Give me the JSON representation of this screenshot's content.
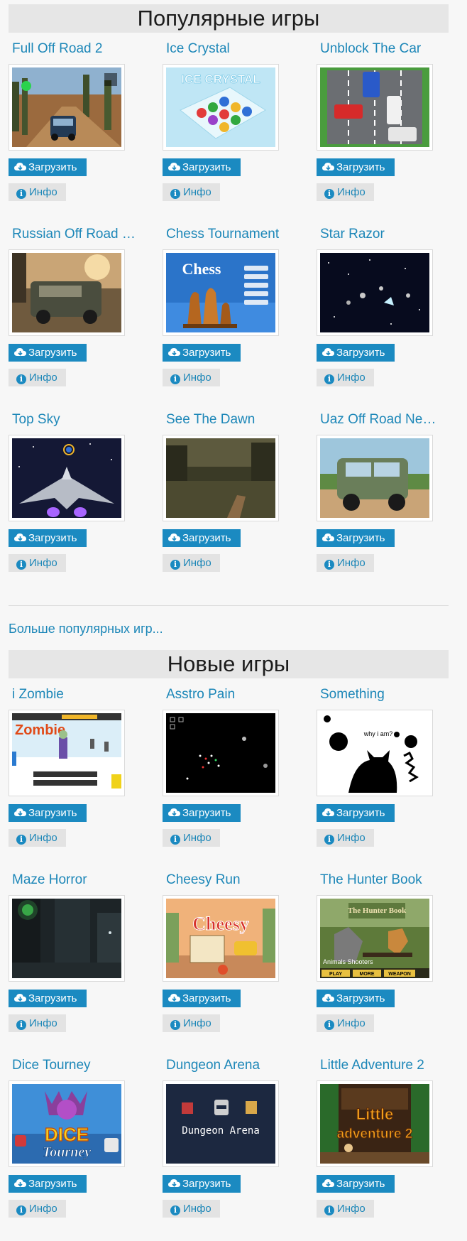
{
  "popular": {
    "title": "Популярные игры",
    "more": "Больше популярных игр...",
    "games": [
      {
        "title": "Full Off Road 2"
      },
      {
        "title": "Ice Crystal"
      },
      {
        "title": "Unblock The Car"
      },
      {
        "title": "Russian Off Road …"
      },
      {
        "title": "Chess Tournament"
      },
      {
        "title": "Star Razor"
      },
      {
        "title": "Top Sky"
      },
      {
        "title": "See The Dawn"
      },
      {
        "title": "Uaz Off Road Ne…"
      }
    ]
  },
  "newgames": {
    "title": "Новые игры",
    "games": [
      {
        "title": "i Zombie"
      },
      {
        "title": "Asstro Pain"
      },
      {
        "title": "Something"
      },
      {
        "title": "Maze Horror"
      },
      {
        "title": "Cheesy Run"
      },
      {
        "title": "The Hunter Book"
      },
      {
        "title": "Dice Tourney"
      },
      {
        "title": "Dungeon Arena"
      },
      {
        "title": "Little Adventure 2"
      }
    ]
  },
  "buttons": {
    "download": "Загрузить",
    "info": "Инфо"
  },
  "thumb_text": {
    "ice_crystal": "ICE CRYSTAL",
    "chess": "Chess",
    "izombie": "Zombie",
    "something": "why i am?",
    "cheesy": "Cheesy",
    "hunter": "The Hunter Book",
    "hunter_sub": "Animals Shooters",
    "hunter_bar": [
      "PLAY",
      "MORE",
      "WEAPON"
    ],
    "dice": [
      "DICE",
      "Tourney"
    ],
    "dungeon": "Dungeon Arena",
    "little": [
      "Little",
      "adventure 2"
    ]
  },
  "colors": {
    "link": "#1d87b8",
    "button": "#1b8ac1",
    "header_bg": "#e6e6e6",
    "info_bg": "#e3e3e3"
  }
}
